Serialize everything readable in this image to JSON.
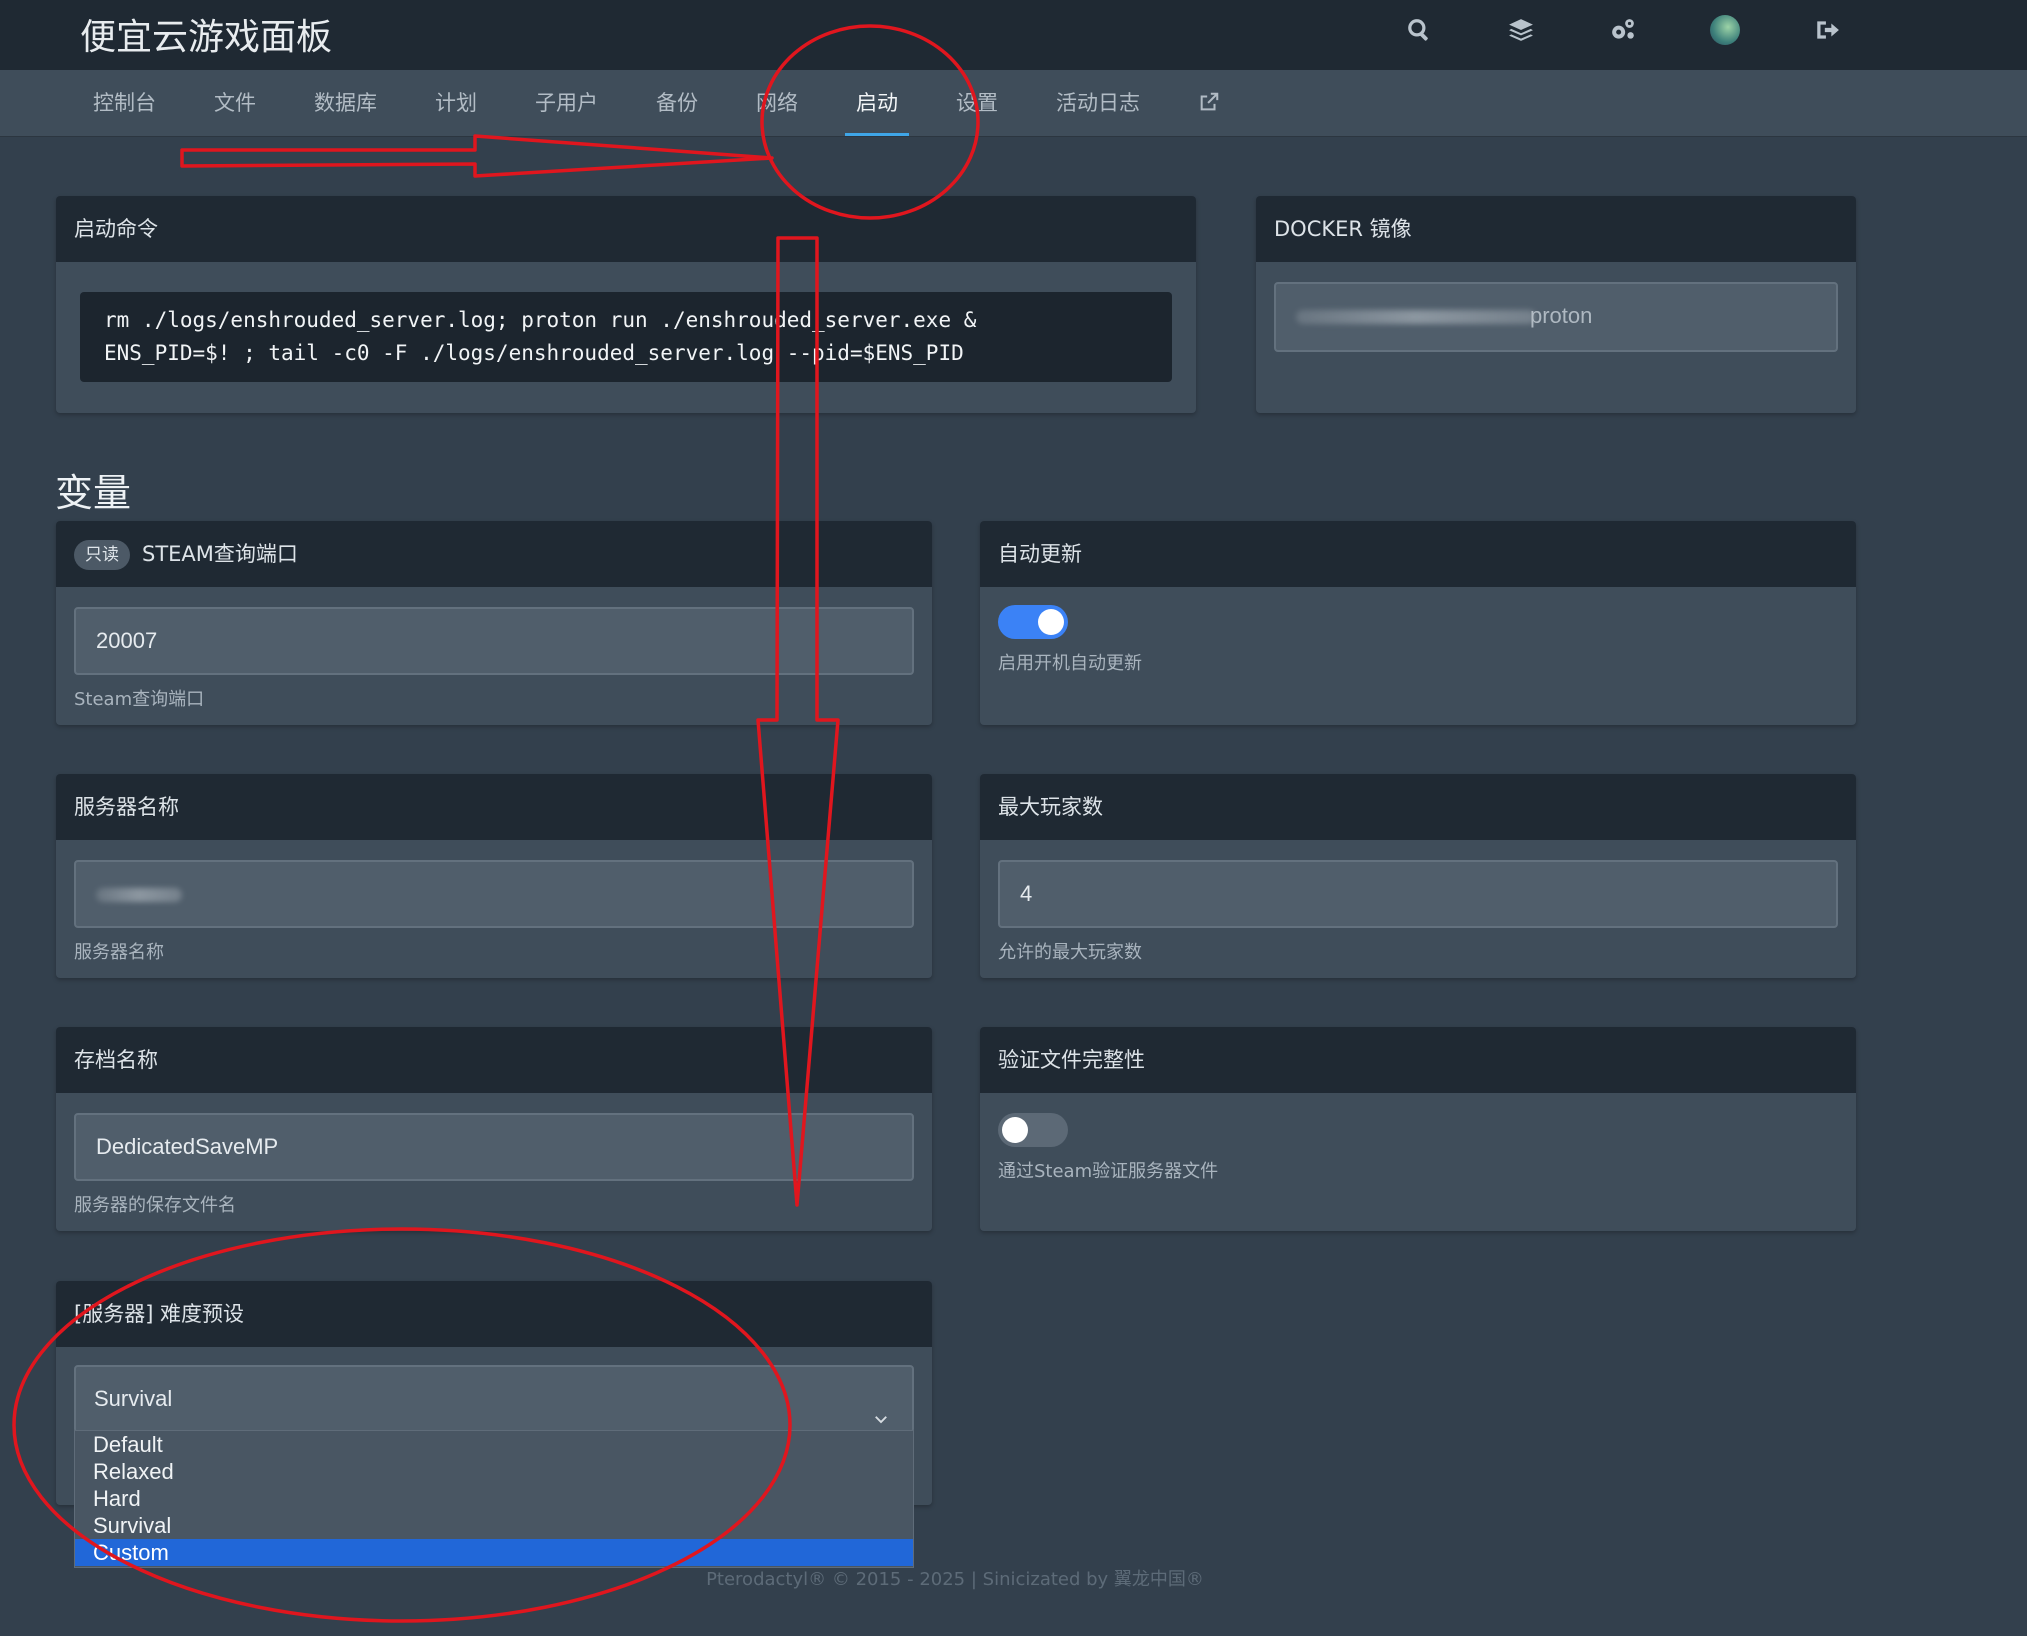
{
  "app": {
    "title": "便宜云游戏面板"
  },
  "header_icons": [
    "search-icon",
    "layers-icon",
    "gear-icon",
    "avatar",
    "logout-icon"
  ],
  "nav": {
    "tabs": [
      {
        "label": "控制台",
        "active": false
      },
      {
        "label": "文件",
        "active": false
      },
      {
        "label": "数据库",
        "active": false
      },
      {
        "label": "计划",
        "active": false
      },
      {
        "label": "子用户",
        "active": false
      },
      {
        "label": "备份",
        "active": false
      },
      {
        "label": "网络",
        "active": false
      },
      {
        "label": "启动",
        "active": true
      },
      {
        "label": "设置",
        "active": false
      },
      {
        "label": "活动日志",
        "active": false
      }
    ],
    "external_icon": "external-link-icon"
  },
  "startup": {
    "title": "启动命令",
    "command_line1": "rm ./logs/enshrouded_server.log; proton run ./enshrouded_server.exe &",
    "command_line2": "ENS_PID=$! ; tail -c0 -F ./logs/enshrouded_server.log --pid=$ENS_PID"
  },
  "docker": {
    "title": "DOCKER 镜像",
    "image_suffix": "proton"
  },
  "variables": {
    "title": "变量",
    "steam_port": {
      "badge": "只读",
      "title": "STEAM查询端口",
      "value": "20007",
      "hint": "Steam查询端口"
    },
    "auto_update": {
      "title": "自动更新",
      "enabled": true,
      "hint": "启用开机自动更新"
    },
    "server_name": {
      "title": "服务器名称",
      "hint": "服务器名称"
    },
    "max_players": {
      "title": "最大玩家数",
      "value": "4",
      "hint": "允许的最大玩家数"
    },
    "save_name": {
      "title": "存档名称",
      "value": "DedicatedSaveMP",
      "hint": "服务器的保存文件名"
    },
    "verify_files": {
      "title": "验证文件完整性",
      "enabled": false,
      "hint": "通过Steam验证服务器文件"
    },
    "difficulty": {
      "title": "[服务器] 难度预设",
      "value": "Survival",
      "options": [
        "Default",
        "Relaxed",
        "Hard",
        "Survival",
        "Custom"
      ],
      "highlighted": "Custom"
    }
  },
  "footer": {
    "text": "Pterodactyl® © 2015 - 2025 | Sinicizated by 翼龙中国®"
  },
  "colors": {
    "accent": "#3fa6e8",
    "toggle_on": "#3b82f6",
    "dropdown_highlight": "#2167d8",
    "annotation": "#e0161e"
  }
}
